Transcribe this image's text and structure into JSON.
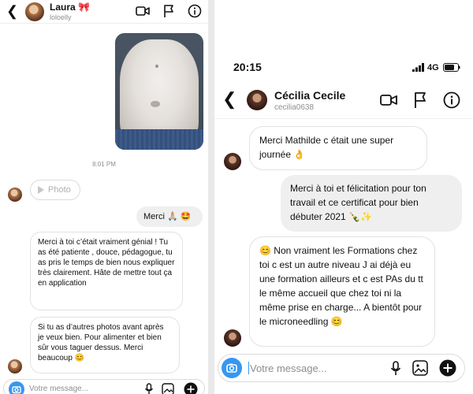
{
  "left_chat": {
    "header": {
      "name": "Laura",
      "name_emoji": "🎀",
      "username": "loloelly"
    },
    "timestamp": "8:01 PM",
    "photo_pill_label": "Photo",
    "outgoing_message": "Merci 🙏🏼 🤩",
    "incoming_messages": [
      "Merci à toi c’était vraiment génial ! Tu as été patiente , douce, pédagogue, tu as pris le temps de bien nous expliquer très clairement. Hâte de mettre tout ça en application",
      "Si tu as d’autres photos avant après je veux bien. Pour alimenter et bien sûr vous taguer dessus. Merci beaucoup 😊"
    ],
    "composer_placeholder": "Votre message..."
  },
  "right_chat": {
    "status": {
      "time": "20:15",
      "network": "4G"
    },
    "header": {
      "name": "Cécilia Cecile",
      "username": "cecilia0638"
    },
    "messages": [
      {
        "direction": "incoming",
        "text": "Merci Mathilde c était une super journée 👌"
      },
      {
        "direction": "outgoing",
        "text": "Merci à toi et félicitation pour ton travail et ce certificat pour bien débuter 2021 🍾✨"
      },
      {
        "direction": "incoming",
        "text": "😊 Non vraiment les Formations chez toi c est un autre niveau J ai déjà eu une formation ailleurs et c est PAs du tt le même accueil que chez toi ni la même prise en charge... A bientôt pour le microneedling 😊"
      }
    ],
    "composer_placeholder": "Votre message..."
  },
  "icons": [
    "back-arrow-icon",
    "video-camera-icon",
    "flag-icon",
    "info-icon",
    "camera-icon",
    "microphone-icon",
    "gallery-icon",
    "add-icon",
    "signal-icon",
    "battery-icon",
    "play-icon"
  ],
  "colors": {
    "accent_blue": "#3797f0",
    "incoming_bubble_border": "#e2e2e2",
    "outgoing_bubble_bg": "#efefef",
    "secondary_text": "#8e8e8e"
  }
}
